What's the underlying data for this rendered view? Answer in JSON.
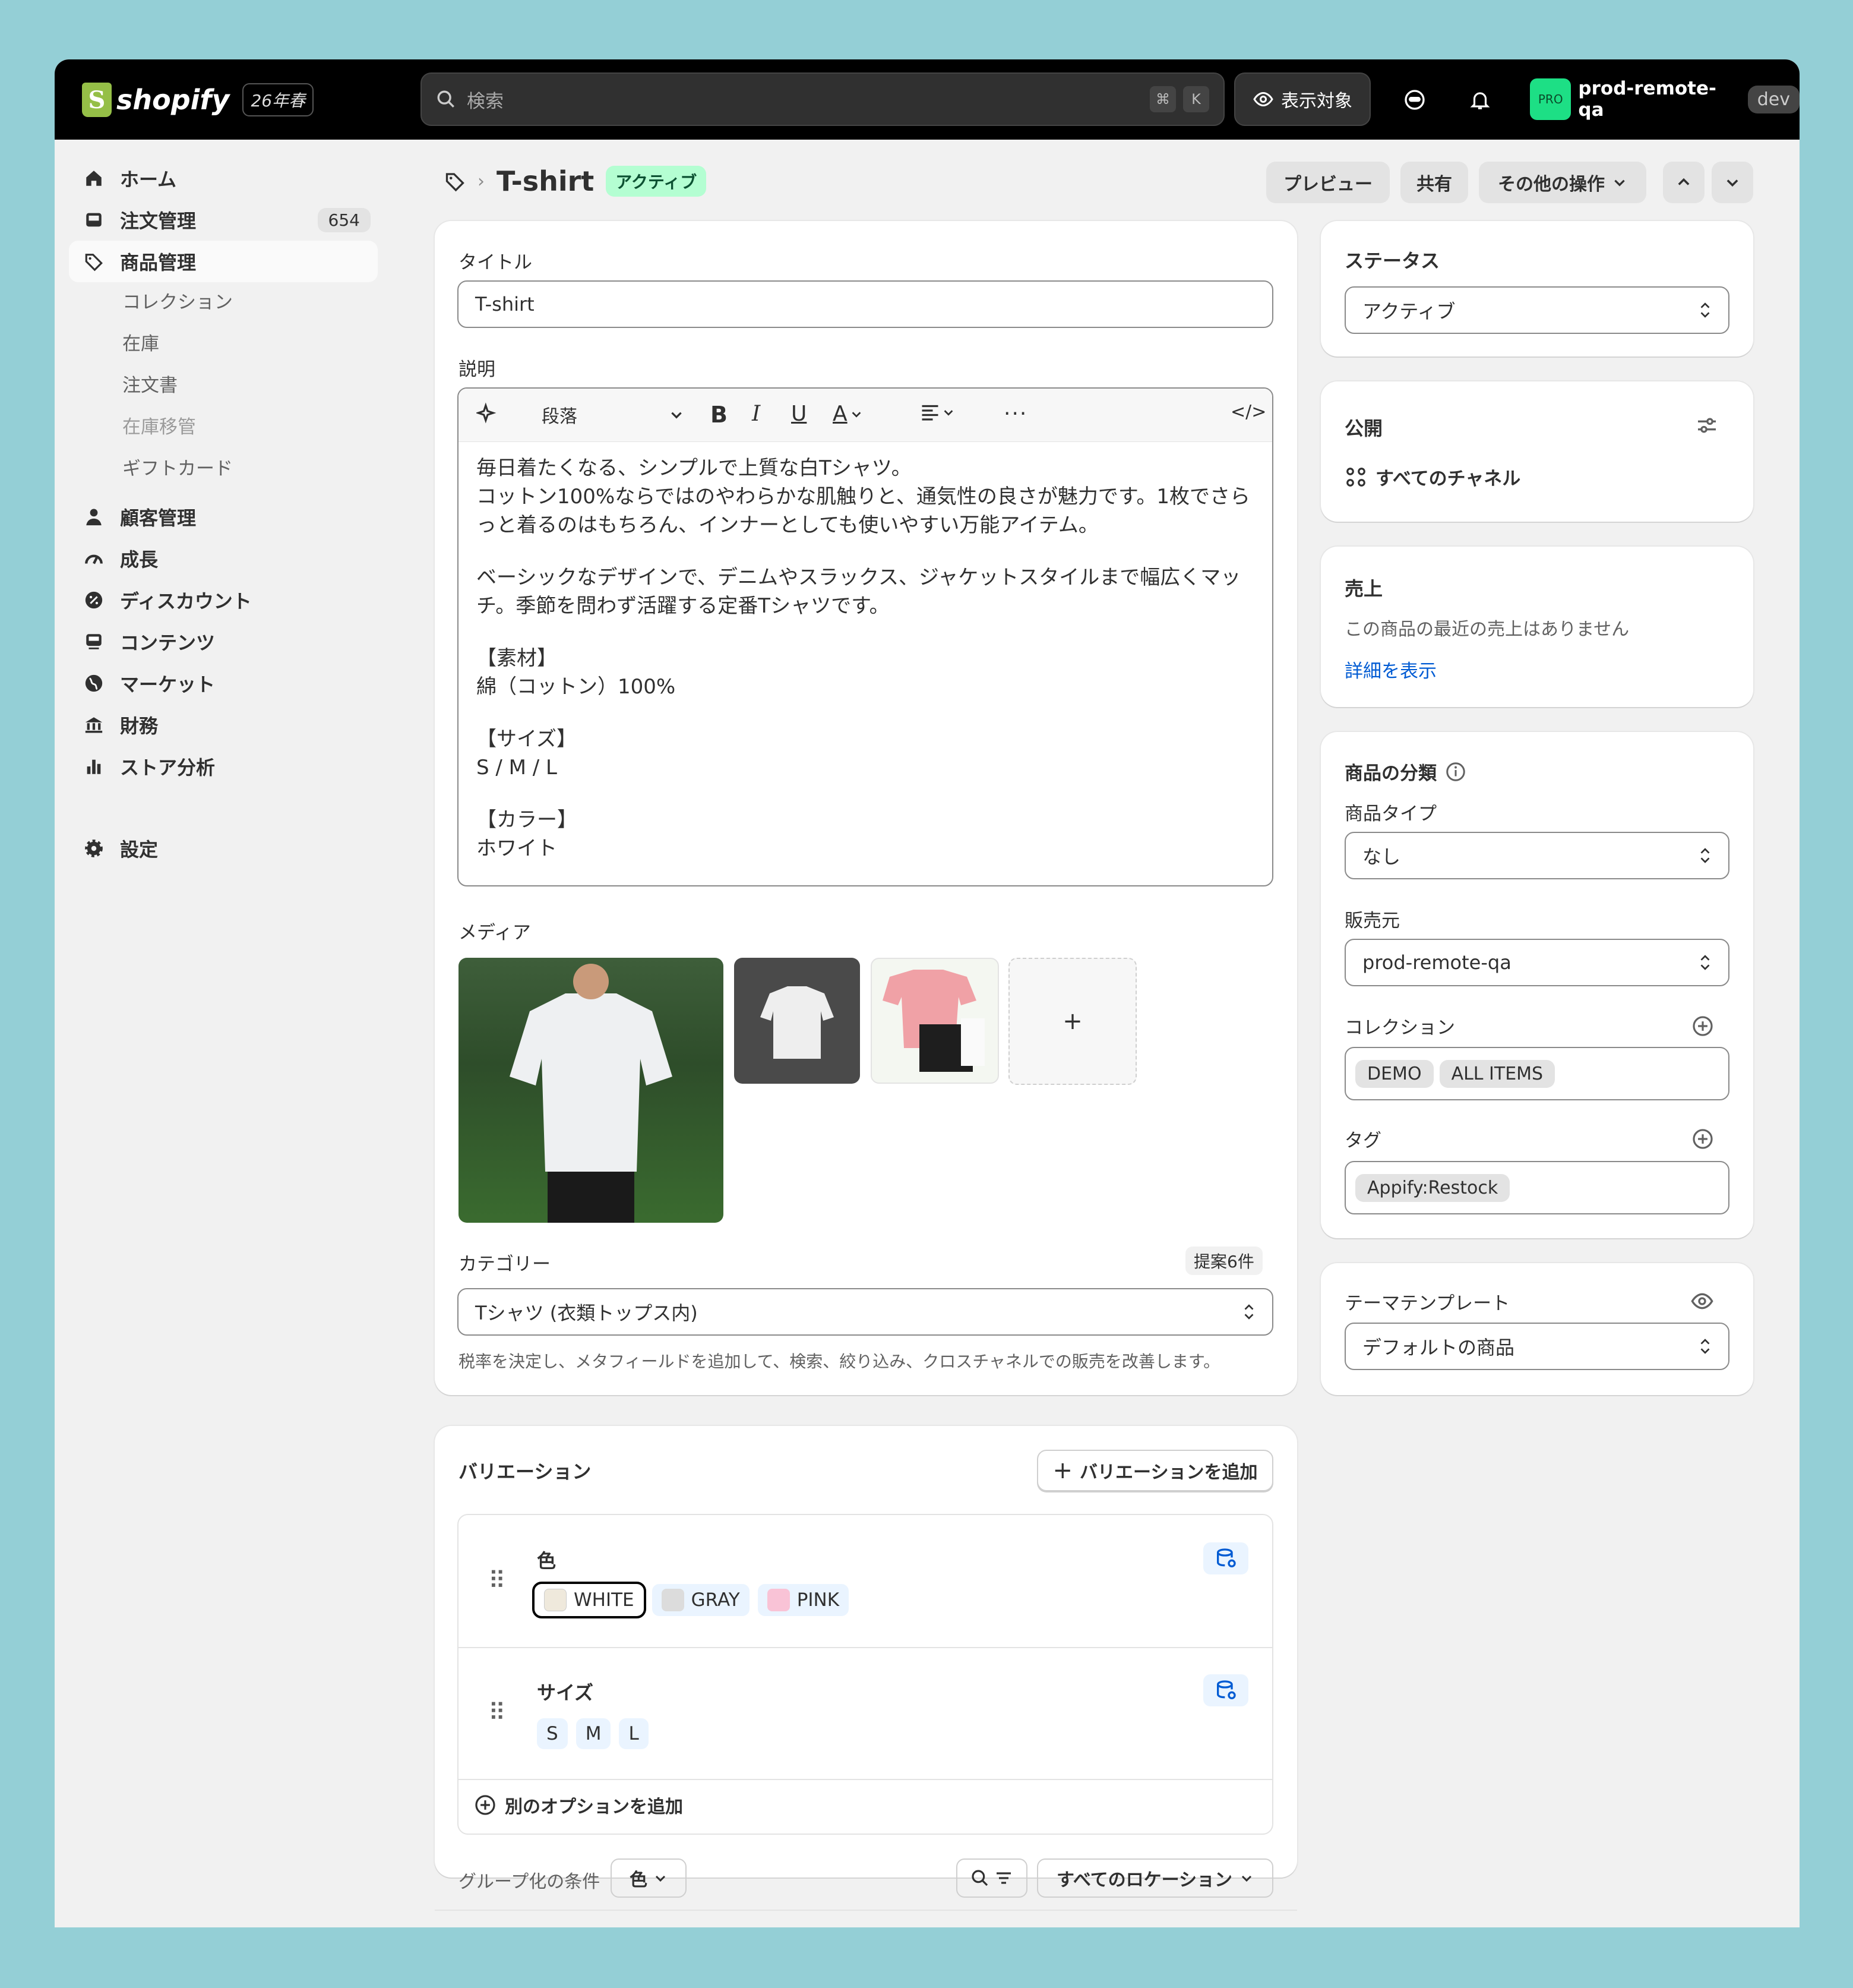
{
  "topbar": {
    "brand": "shopify",
    "season": "26年春",
    "search_placeholder": "検索",
    "shortcut_cmd": "⌘",
    "shortcut_key": "K",
    "visibility_label": "表示対象",
    "store_badge": "PRO",
    "store_name": "prod-remote-qa",
    "env": "dev"
  },
  "sidebar": {
    "items": [
      {
        "label": "ホーム",
        "icon": "home-icon"
      },
      {
        "label": "注文管理",
        "icon": "inbox-icon",
        "count": "654"
      },
      {
        "label": "商品管理",
        "icon": "tag-icon"
      },
      {
        "label": "顧客管理",
        "icon": "person-icon"
      },
      {
        "label": "成長",
        "icon": "gauge-icon"
      },
      {
        "label": "ディスカウント",
        "icon": "discount-icon"
      },
      {
        "label": "コンテンツ",
        "icon": "content-icon"
      },
      {
        "label": "マーケット",
        "icon": "globe-icon"
      },
      {
        "label": "財務",
        "icon": "bank-icon"
      },
      {
        "label": "ストア分析",
        "icon": "bar-chart-icon"
      },
      {
        "label": "設定",
        "icon": "gear-icon"
      }
    ],
    "subitems": [
      "コレクション",
      "在庫",
      "注文書",
      "在庫移管",
      "ギフトカード"
    ]
  },
  "header": {
    "title": "T-shirt",
    "status_badge": "アクティブ",
    "preview": "プレビュー",
    "share": "共有",
    "more_actions": "その他の操作"
  },
  "product": {
    "title_label": "タイトル",
    "title_value": "T-shirt",
    "description_label": "説明",
    "toolbar_paragraph": "段落",
    "description": [
      "毎日着たくなる、シンプルで上質な白Tシャツ。\nコットン100%ならではのやわらかな肌触りと、通気性の良さが魅力です。1枚でさらっと着るのはもちろん、インナーとしても使いやすい万能アイテム。",
      "ベーシックなデザインで、デニムやスラックス、ジャケットスタイルまで幅広くマッチ。季節を問わず活躍する定番Tシャツです。",
      "【素材】\n綿（コットン）100%",
      "【サイズ】\nS / M / L",
      "【カラー】\nホワイト"
    ],
    "media_label": "メディア",
    "media_add": "+",
    "category_label": "カテゴリー",
    "category_suggest": "提案6件",
    "category_value": "Tシャツ (衣類トップス内)",
    "category_help": "税率を決定し、メタフィールドを追加して、検索、絞り込み、クロスチャネルでの販売を改善します。"
  },
  "variants": {
    "title": "バリエーション",
    "add_button": "バリエーションを追加",
    "options": [
      {
        "name": "色",
        "values": [
          {
            "label": "WHITE",
            "swatch": "#efe9dc"
          },
          {
            "label": "GRAY",
            "swatch": "#dcdcdc"
          },
          {
            "label": "PINK",
            "swatch": "#f9c3d6"
          }
        ]
      },
      {
        "name": "サイズ",
        "values": [
          {
            "label": "S"
          },
          {
            "label": "M"
          },
          {
            "label": "L"
          }
        ]
      }
    ],
    "add_option": "別のオプションを追加",
    "group_by_label": "グループ化の条件",
    "group_by_value": "色",
    "locations": "すべてのロケーション"
  },
  "status_card": {
    "title": "ステータス",
    "value": "アクティブ"
  },
  "publish_card": {
    "title": "公開",
    "channels": "すべてのチャネル"
  },
  "sales_card": {
    "title": "売上",
    "text": "この商品の最近の売上はありません",
    "link": "詳細を表示"
  },
  "org_card": {
    "title": "商品の分類",
    "type_label": "商品タイプ",
    "type_value": "なし",
    "vendor_label": "販売元",
    "vendor_value": "prod-remote-qa",
    "collections_label": "コレクション",
    "collections": [
      "DEMO",
      "ALL ITEMS"
    ],
    "tags_label": "タグ",
    "tags": [
      "Appify:Restock"
    ]
  },
  "theme_card": {
    "title": "テーマテンプレート",
    "value": "デフォルトの商品"
  },
  "colors": {
    "accent_green": "#1ddf85",
    "link": "#005bd3",
    "frame": "#94cfd6"
  }
}
